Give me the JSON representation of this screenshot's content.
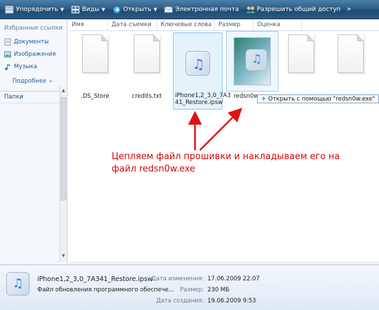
{
  "toolbar": {
    "organize": "Упорядочить",
    "views": "Виды",
    "open": "Открыть",
    "email": "Электронная почта",
    "share": "Разрешить общий доступ",
    "more": "»"
  },
  "sidebar": {
    "favorites_header": "Избранные ссылки",
    "items": [
      {
        "label": "Документы",
        "icon": "documents-icon"
      },
      {
        "label": "Изображения",
        "icon": "pictures-icon"
      },
      {
        "label": "Музыка",
        "icon": "music-icon"
      }
    ],
    "more": "Подробнее",
    "folders": "Папки"
  },
  "columns": [
    "Имя",
    "Дата съемки",
    "Ключевые слова",
    "Размер",
    "Оценка"
  ],
  "files": [
    {
      "name": ".DS_Store",
      "type": "document"
    },
    {
      "name": "credits.txt",
      "type": "document"
    },
    {
      "name": "iPhone1,2_3,0_7A3",
      "name_line2": "41_Restore.ipsw",
      "type": "itunes"
    },
    {
      "name": "redsn0w.e",
      "type": "app"
    },
    {
      "name": "",
      "type": "document"
    },
    {
      "name": "",
      "type": "document"
    }
  ],
  "tooltip": "Открыть с помощью \"redsn0w.exe\"",
  "annotation": {
    "line1": "Цепляем файл прошивки и накладываем его на",
    "line2": "файл redsn0w.exe"
  },
  "details": {
    "filename": "iPhone1,2_3,0_7A341_Restore.ipsw",
    "filetype": "Файл обновления программного обеспече...",
    "modified_label": "Дата изменения:",
    "modified_value": "17.06.2009 22:07",
    "size_label": "Размер:",
    "size_value": "230 МБ",
    "created_label": "Дата создания:",
    "created_value": "19.06.2009 9:53"
  },
  "colors": {
    "toolbar": "#2f5e87",
    "link": "#1d5e9c",
    "annotation": "#d10808",
    "selection": "#cde8fa"
  }
}
